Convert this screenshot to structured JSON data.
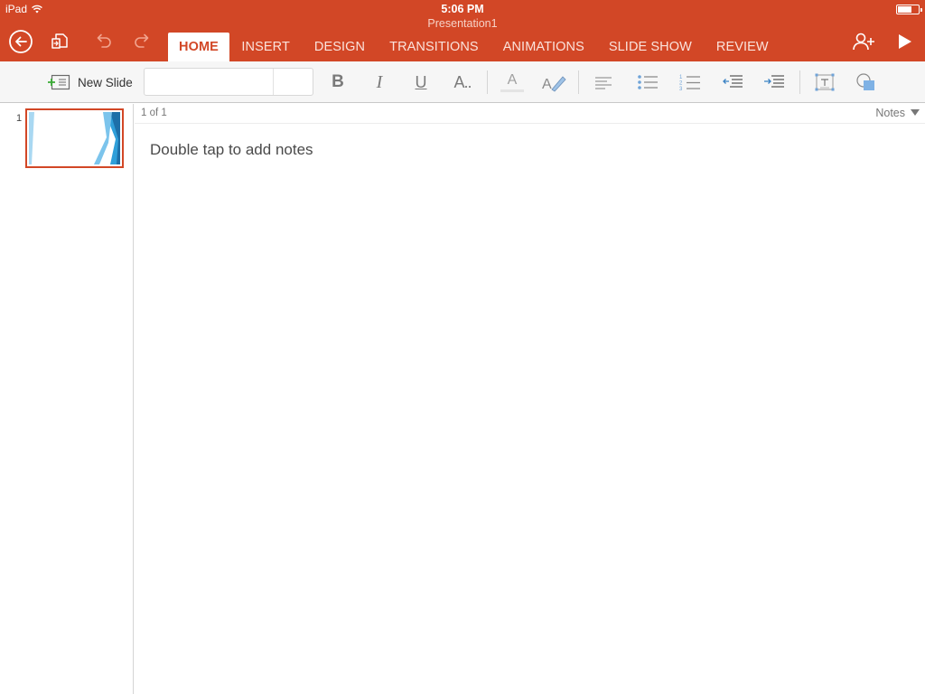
{
  "status_bar": {
    "device": "iPad",
    "time": "5:06 PM"
  },
  "document": {
    "title": "Presentation1"
  },
  "header": {
    "back_icon": "back-arrow-icon",
    "file_icon": "file-menu-icon",
    "undo_icon": "undo-icon",
    "redo_icon": "redo-icon",
    "share_icon": "share-person-icon",
    "play_icon": "play-slideshow-icon"
  },
  "tabs": [
    {
      "label": "HOME",
      "active": true
    },
    {
      "label": "INSERT"
    },
    {
      "label": "DESIGN"
    },
    {
      "label": "TRANSITIONS"
    },
    {
      "label": "ANIMATIONS"
    },
    {
      "label": "SLIDE SHOW"
    },
    {
      "label": "REVIEW"
    }
  ],
  "ribbon": {
    "new_slide_label": "New Slide",
    "font_name": "",
    "font_size": "",
    "bold_glyph": "B",
    "italic_glyph": "I",
    "underline_glyph": "U",
    "text_effects_glyph": "A..",
    "font_color_glyph": "A"
  },
  "slides": [
    {
      "number": "1",
      "selected": true
    }
  ],
  "notes_bar": {
    "counter": "1 of 1",
    "toggle_label": "Notes"
  },
  "notes": {
    "placeholder": "Double tap to add notes"
  },
  "colors": {
    "accent": "#d24726",
    "ribbon_bg": "#f6f6f6",
    "thumb_blue": "#2f9fd9"
  }
}
